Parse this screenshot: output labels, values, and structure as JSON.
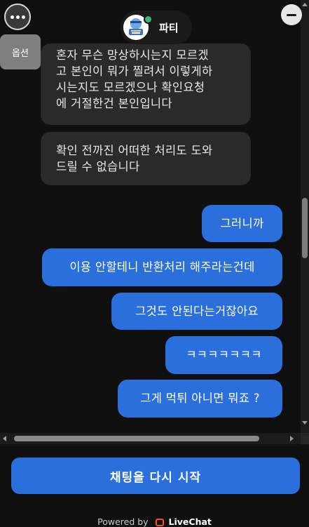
{
  "header": {
    "options_label": "옵션",
    "agent_name": "파티"
  },
  "messages": [
    {
      "from": "agent",
      "text": "혼자 무슨 망상하시는지 모르겠\n고 본인이 뭐가 찔려서 이렇게하\n시는지도 모르겠으나 확인요청\n에 거절한건 본인입니다"
    },
    {
      "from": "agent",
      "text": "확인 전까진 어떠한 처리도 도와\n드릴 수 없습니다"
    },
    {
      "from": "user",
      "text": "그러니까"
    },
    {
      "from": "user",
      "text": "이용 안할테니 반환처리 해주라는건데"
    },
    {
      "from": "user",
      "text": "그것도 안된다는거잖아요"
    },
    {
      "from": "user",
      "text": "ㅋㅋㅋㅋㅋㅋㅋ"
    },
    {
      "from": "user",
      "text": "그게 먹튀 아니면 뭐죠 ?"
    }
  ],
  "footer": {
    "restart_label": "채팅을 다시 시작",
    "powered_by": "Powered by",
    "brand": "LiveChat"
  },
  "colors": {
    "user_bubble": "#2a6fdb",
    "agent_bubble": "#2a2a2a",
    "background": "#0f0f0f",
    "brand_accent": "#ff5100"
  },
  "icons": {
    "options": "ellipsis-icon",
    "minimize": "minimize-icon",
    "brand": "livechat-logo-icon"
  }
}
